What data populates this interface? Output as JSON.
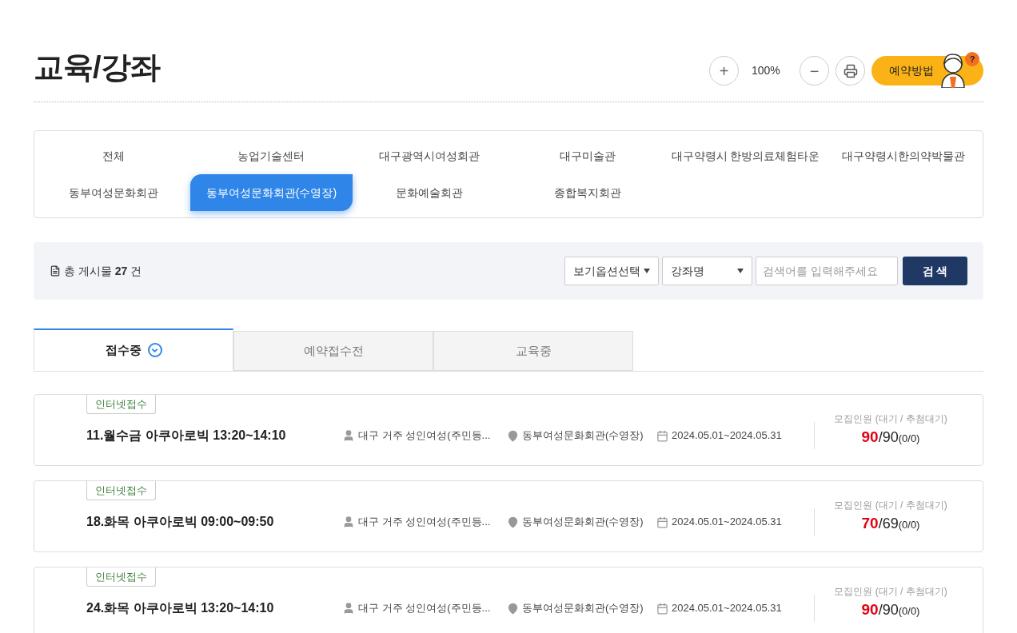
{
  "page_title": "교육/강좌",
  "toolbar": {
    "zoom_in": "+",
    "zoom_level": "100%",
    "zoom_out": "−",
    "help_button": "예약방법",
    "help_badge": "?"
  },
  "categories": [
    {
      "label": "전체",
      "selected": false
    },
    {
      "label": "농업기술센터",
      "selected": false
    },
    {
      "label": "대구광역시여성회관",
      "selected": false
    },
    {
      "label": "대구미술관",
      "selected": false
    },
    {
      "label": "대구약령시 한방의료체험타운",
      "selected": false
    },
    {
      "label": "대구약령시한의약박물관",
      "selected": false
    },
    {
      "label": "동부여성문화회관",
      "selected": false
    },
    {
      "label": "동부여성문화회관(수영장)",
      "selected": true
    },
    {
      "label": "문화예술회관",
      "selected": false
    },
    {
      "label": "종합복지회관",
      "selected": false
    }
  ],
  "search_bar": {
    "count": "총 게시물 **27** 건",
    "view_option": "보기옵션선택",
    "field_select": "강좌명",
    "placeholder": "검색어를 입력해주세요",
    "search_button": "검 색"
  },
  "status_tabs": [
    {
      "label": "접수중",
      "selected": true
    },
    {
      "label": "예약접수전",
      "selected": false
    },
    {
      "label": "교육중",
      "selected": false
    }
  ],
  "courses": [
    {
      "badge": "인터넷접수",
      "title": "11.월수금 아쿠아로빅 13:20~14:10",
      "target": "대구 거주 성인여성(주민등...",
      "place": "동부여성문화회관(수영장)",
      "period": "2024.05.01~2024.05.31",
      "capacity_label": "모집인원 (대기 / 추첨대기)",
      "applied": "90",
      "total": "/90",
      "waiting": "(0/0)"
    },
    {
      "badge": "인터넷접수",
      "title": "18.화목 아쿠아로빅 09:00~09:50",
      "target": "대구 거주 성인여성(주민등...",
      "place": "동부여성문화회관(수영장)",
      "period": "2024.05.01~2024.05.31",
      "capacity_label": "모집인원 (대기 / 추첨대기)",
      "applied": "70",
      "total": "/69",
      "waiting": "(0/0)"
    },
    {
      "badge": "인터넷접수",
      "title": "24.화목 아쿠아로빅 13:20~14:10",
      "target": "대구 거주 성인여성(주민등...",
      "place": "동부여성문화회관(수영장)",
      "period": "2024.05.01~2024.05.31",
      "capacity_label": "모집인원 (대기 / 추첨대기)",
      "applied": "90",
      "total": "/90",
      "waiting": "(0/0)"
    }
  ]
}
